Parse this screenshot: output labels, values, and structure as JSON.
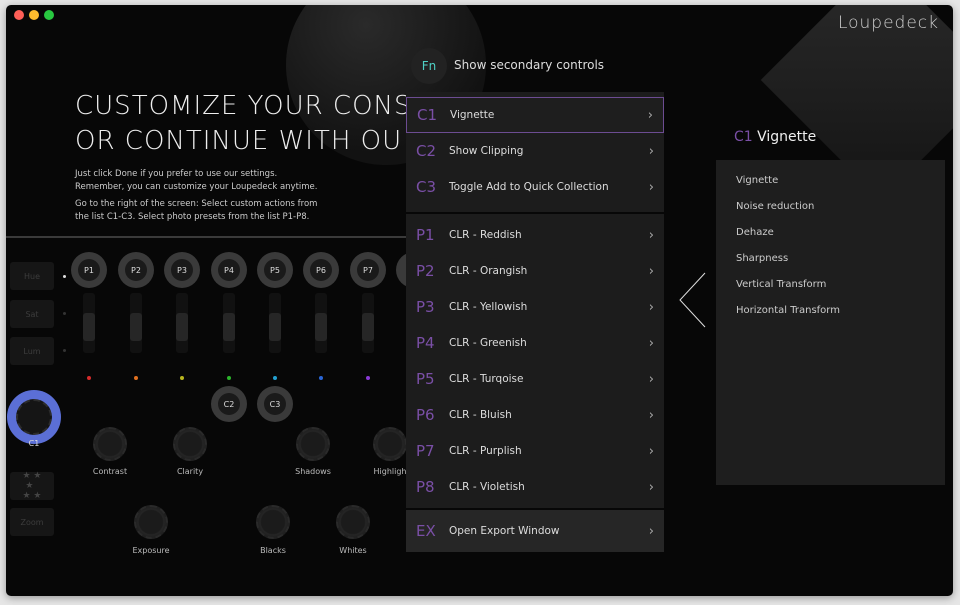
{
  "window": {
    "traffic_lights": [
      "#fe5f57",
      "#febc2e",
      "#28c840"
    ]
  },
  "logo": "Loupedeck",
  "heading": {
    "line1": "CUSTOMIZE YOUR CONS",
    "line2": "OR CONTINUE WITH OU"
  },
  "intro": {
    "p1a": "Just click Done if you prefer to use our settings.",
    "p1b": "Remember, you can customize your Loupedeck anytime.",
    "p2a": "Go to the right of the screen: Select custom actions from",
    "p2b": "the list C1-C3. Select photo presets from the list P1-P8."
  },
  "side_buttons": [
    "Hue",
    "Sat",
    "Lum",
    "Zoom"
  ],
  "preset_knobs": [
    "P1",
    "P2",
    "P3",
    "P4",
    "P5",
    "P6",
    "P7"
  ],
  "slider_colors": [
    "#d62b2b",
    "#e0701f",
    "#b8b51e",
    "#2bb52b",
    "#22a0d0",
    "#2a66d6",
    "#8a3ad6"
  ],
  "custom_knobs": {
    "c1": "C1",
    "c2": "C2",
    "c3": "C3"
  },
  "dials_row1": [
    "Contrast",
    "Clarity",
    "Shadows",
    "Highligh"
  ],
  "dials_row2": [
    "Exposure",
    "Blacks",
    "Whites"
  ],
  "fn": {
    "key": "Fn",
    "label": "Show secondary controls"
  },
  "menu": {
    "custom": [
      {
        "key": "C1",
        "label": "Vignette",
        "selected": true
      },
      {
        "key": "C2",
        "label": "Show Clipping"
      },
      {
        "key": "C3",
        "label": "Toggle Add to Quick Collection"
      }
    ],
    "presets": [
      {
        "key": "P1",
        "label": "CLR - Reddish"
      },
      {
        "key": "P2",
        "label": "CLR - Orangish"
      },
      {
        "key": "P3",
        "label": "CLR - Yellowish"
      },
      {
        "key": "P4",
        "label": "CLR - Greenish"
      },
      {
        "key": "P5",
        "label": "CLR - Turqoise"
      },
      {
        "key": "P6",
        "label": "CLR - Bluish"
      },
      {
        "key": "P7",
        "label": "CLR - Purplish"
      },
      {
        "key": "P8",
        "label": "CLR - Violetish"
      }
    ],
    "export": {
      "key": "EX",
      "label": "Open Export Window"
    },
    "chevron": "›"
  },
  "detail": {
    "key": "C1",
    "title": "Vignette",
    "options": [
      "Vignette",
      "Noise reduction",
      "Dehaze",
      "Sharpness",
      "Vertical Transform",
      "Horizontal Transform"
    ]
  },
  "colors": {
    "accent": "#7a4fa6",
    "c1_ring": "#5b6fd6",
    "fn": "#4fd1c5"
  }
}
